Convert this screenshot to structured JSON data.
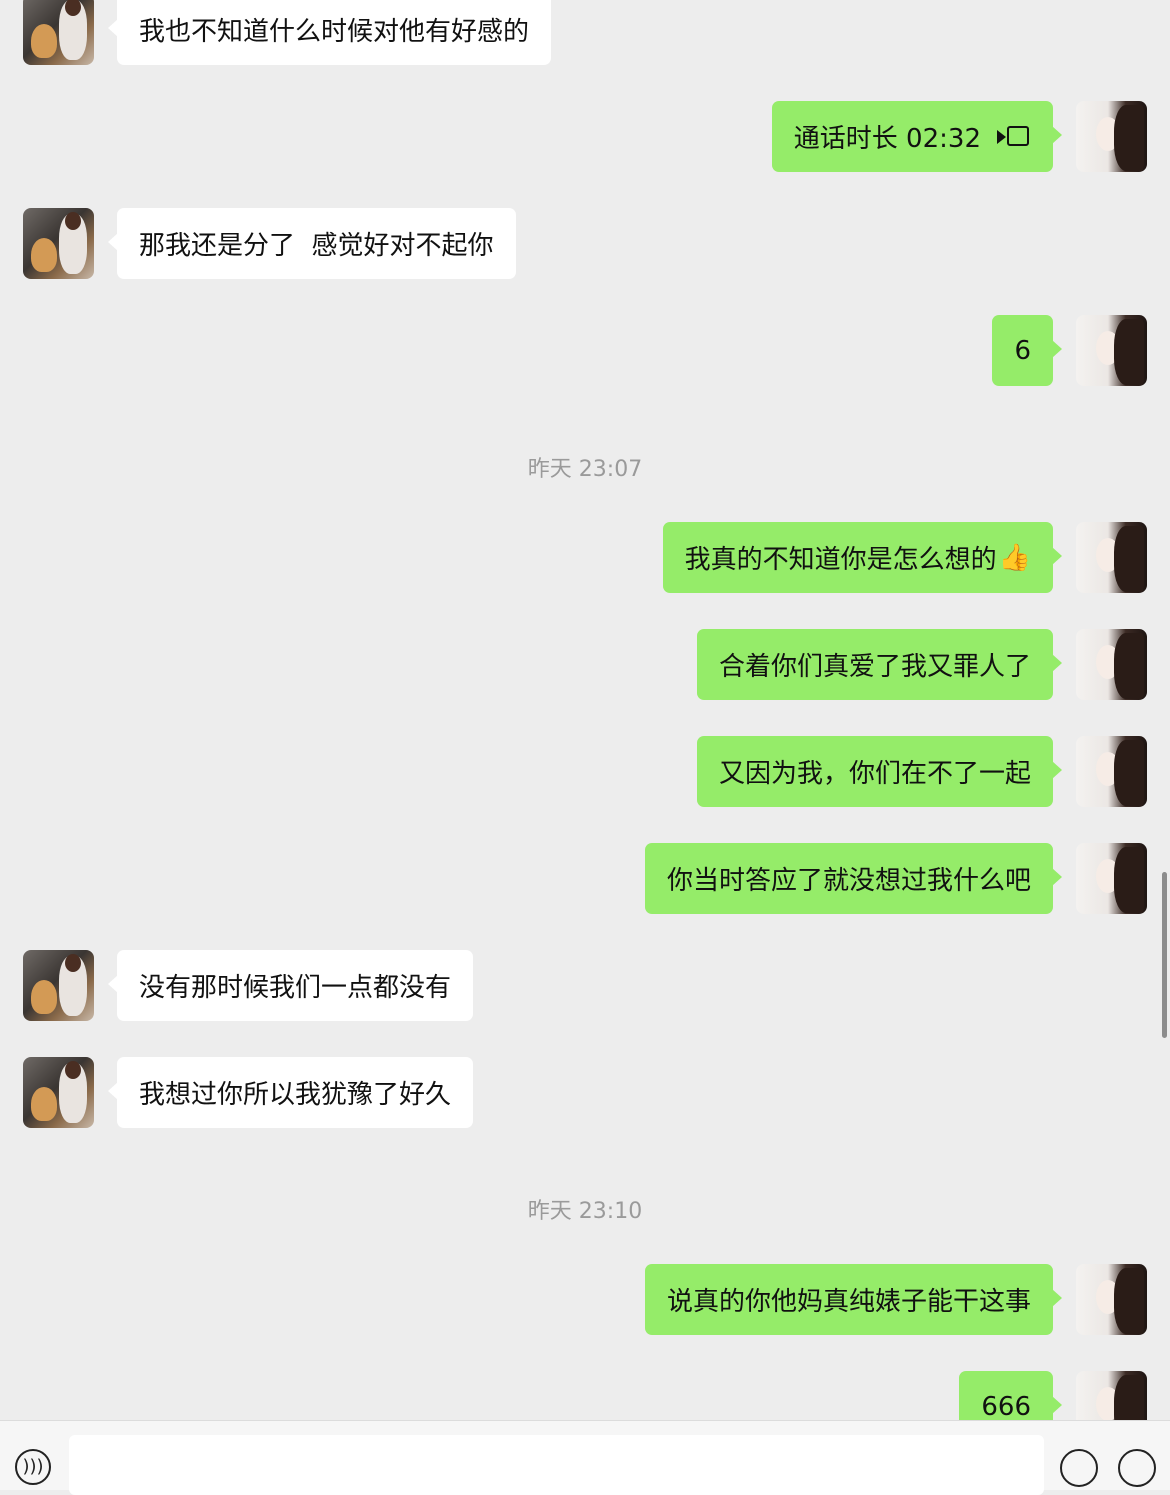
{
  "messages": [
    {
      "side": "left",
      "text": "我也不知道什么时候对他有好感的"
    },
    {
      "side": "right",
      "text": "通话时长 02:32",
      "icon": "video-call-icon"
    },
    {
      "side": "left",
      "text": "那我还是分了  感觉好对不起你"
    },
    {
      "side": "right",
      "text": "6"
    },
    {
      "timestamp": "昨天 23:07"
    },
    {
      "side": "right",
      "text": "我真的不知道你是怎么想的",
      "emoji": "👍"
    },
    {
      "side": "right",
      "text": "合着你们真爱了我又罪人了"
    },
    {
      "side": "right",
      "text": "又因为我，你们在不了一起"
    },
    {
      "side": "right",
      "text": "你当时答应了就没想过我什么吧"
    },
    {
      "side": "left",
      "text": "没有那时候我们一点都没有"
    },
    {
      "side": "left",
      "text": "我想过你所以我犹豫了好久"
    },
    {
      "timestamp": "昨天 23:10"
    },
    {
      "side": "right",
      "text": "说真的你他妈真纯婊子能干这事"
    },
    {
      "side": "right",
      "text": "666"
    }
  ],
  "input": {
    "value": "",
    "voice_icon": "voice-icon",
    "emoji_icon": "emoji-icon",
    "more_icon": "plus-icon"
  },
  "colors": {
    "background": "#ededed",
    "sent_bubble": "#95ec69",
    "received_bubble": "#ffffff",
    "timestamp": "#9a9a9a"
  }
}
